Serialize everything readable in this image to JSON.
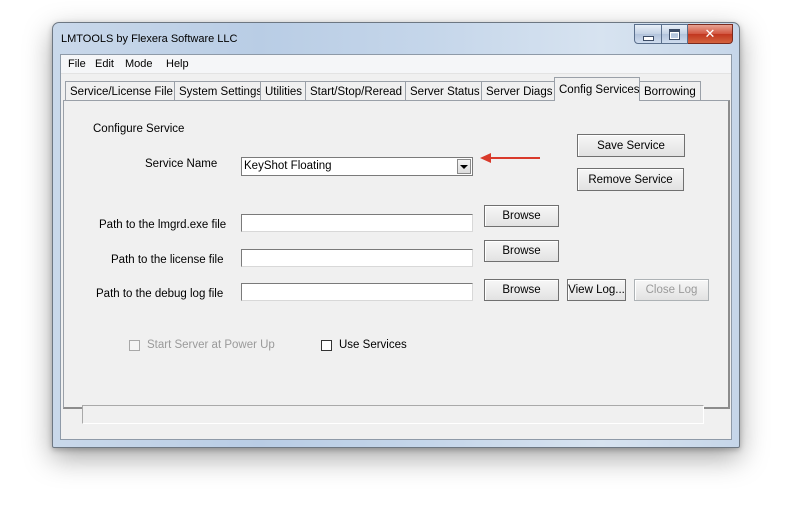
{
  "window": {
    "title": "LMTOOLS by Flexera Software LLC",
    "close_glyph": "✕"
  },
  "menu": [
    "File",
    "Edit",
    "Mode",
    "Help"
  ],
  "tabs": [
    "Service/License File",
    "System Settings",
    "Utilities",
    "Start/Stop/Reread",
    "Server Status",
    "Server Diags",
    "Config Services",
    "Borrowing"
  ],
  "active_tab": "Config Services",
  "config": {
    "group_label": "Configure Service",
    "service_name_label": "Service Name",
    "service_name_value": "KeyShot Floating",
    "save_service": "Save Service",
    "remove_service": "Remove Service",
    "lmgrd_label": "Path to the lmgrd.exe file",
    "lmgrd_value": "",
    "license_label": "Path to the license file",
    "license_value": "",
    "debug_label": "Path to the debug log file",
    "debug_value": "",
    "browse": "Browse",
    "view_log": "View Log...",
    "close_log": "Close Log",
    "start_at_powerup": "Start Server at Power Up",
    "use_services": "Use Services"
  },
  "colors": {
    "arrow": "#d93a2b",
    "close_button": "#c1361f"
  },
  "icons": {
    "minimize": "minimize-icon",
    "maximize": "maximize-icon",
    "close": "close-icon",
    "dropdown": "chevron-down-icon",
    "annotation": "red-arrow-icon"
  }
}
